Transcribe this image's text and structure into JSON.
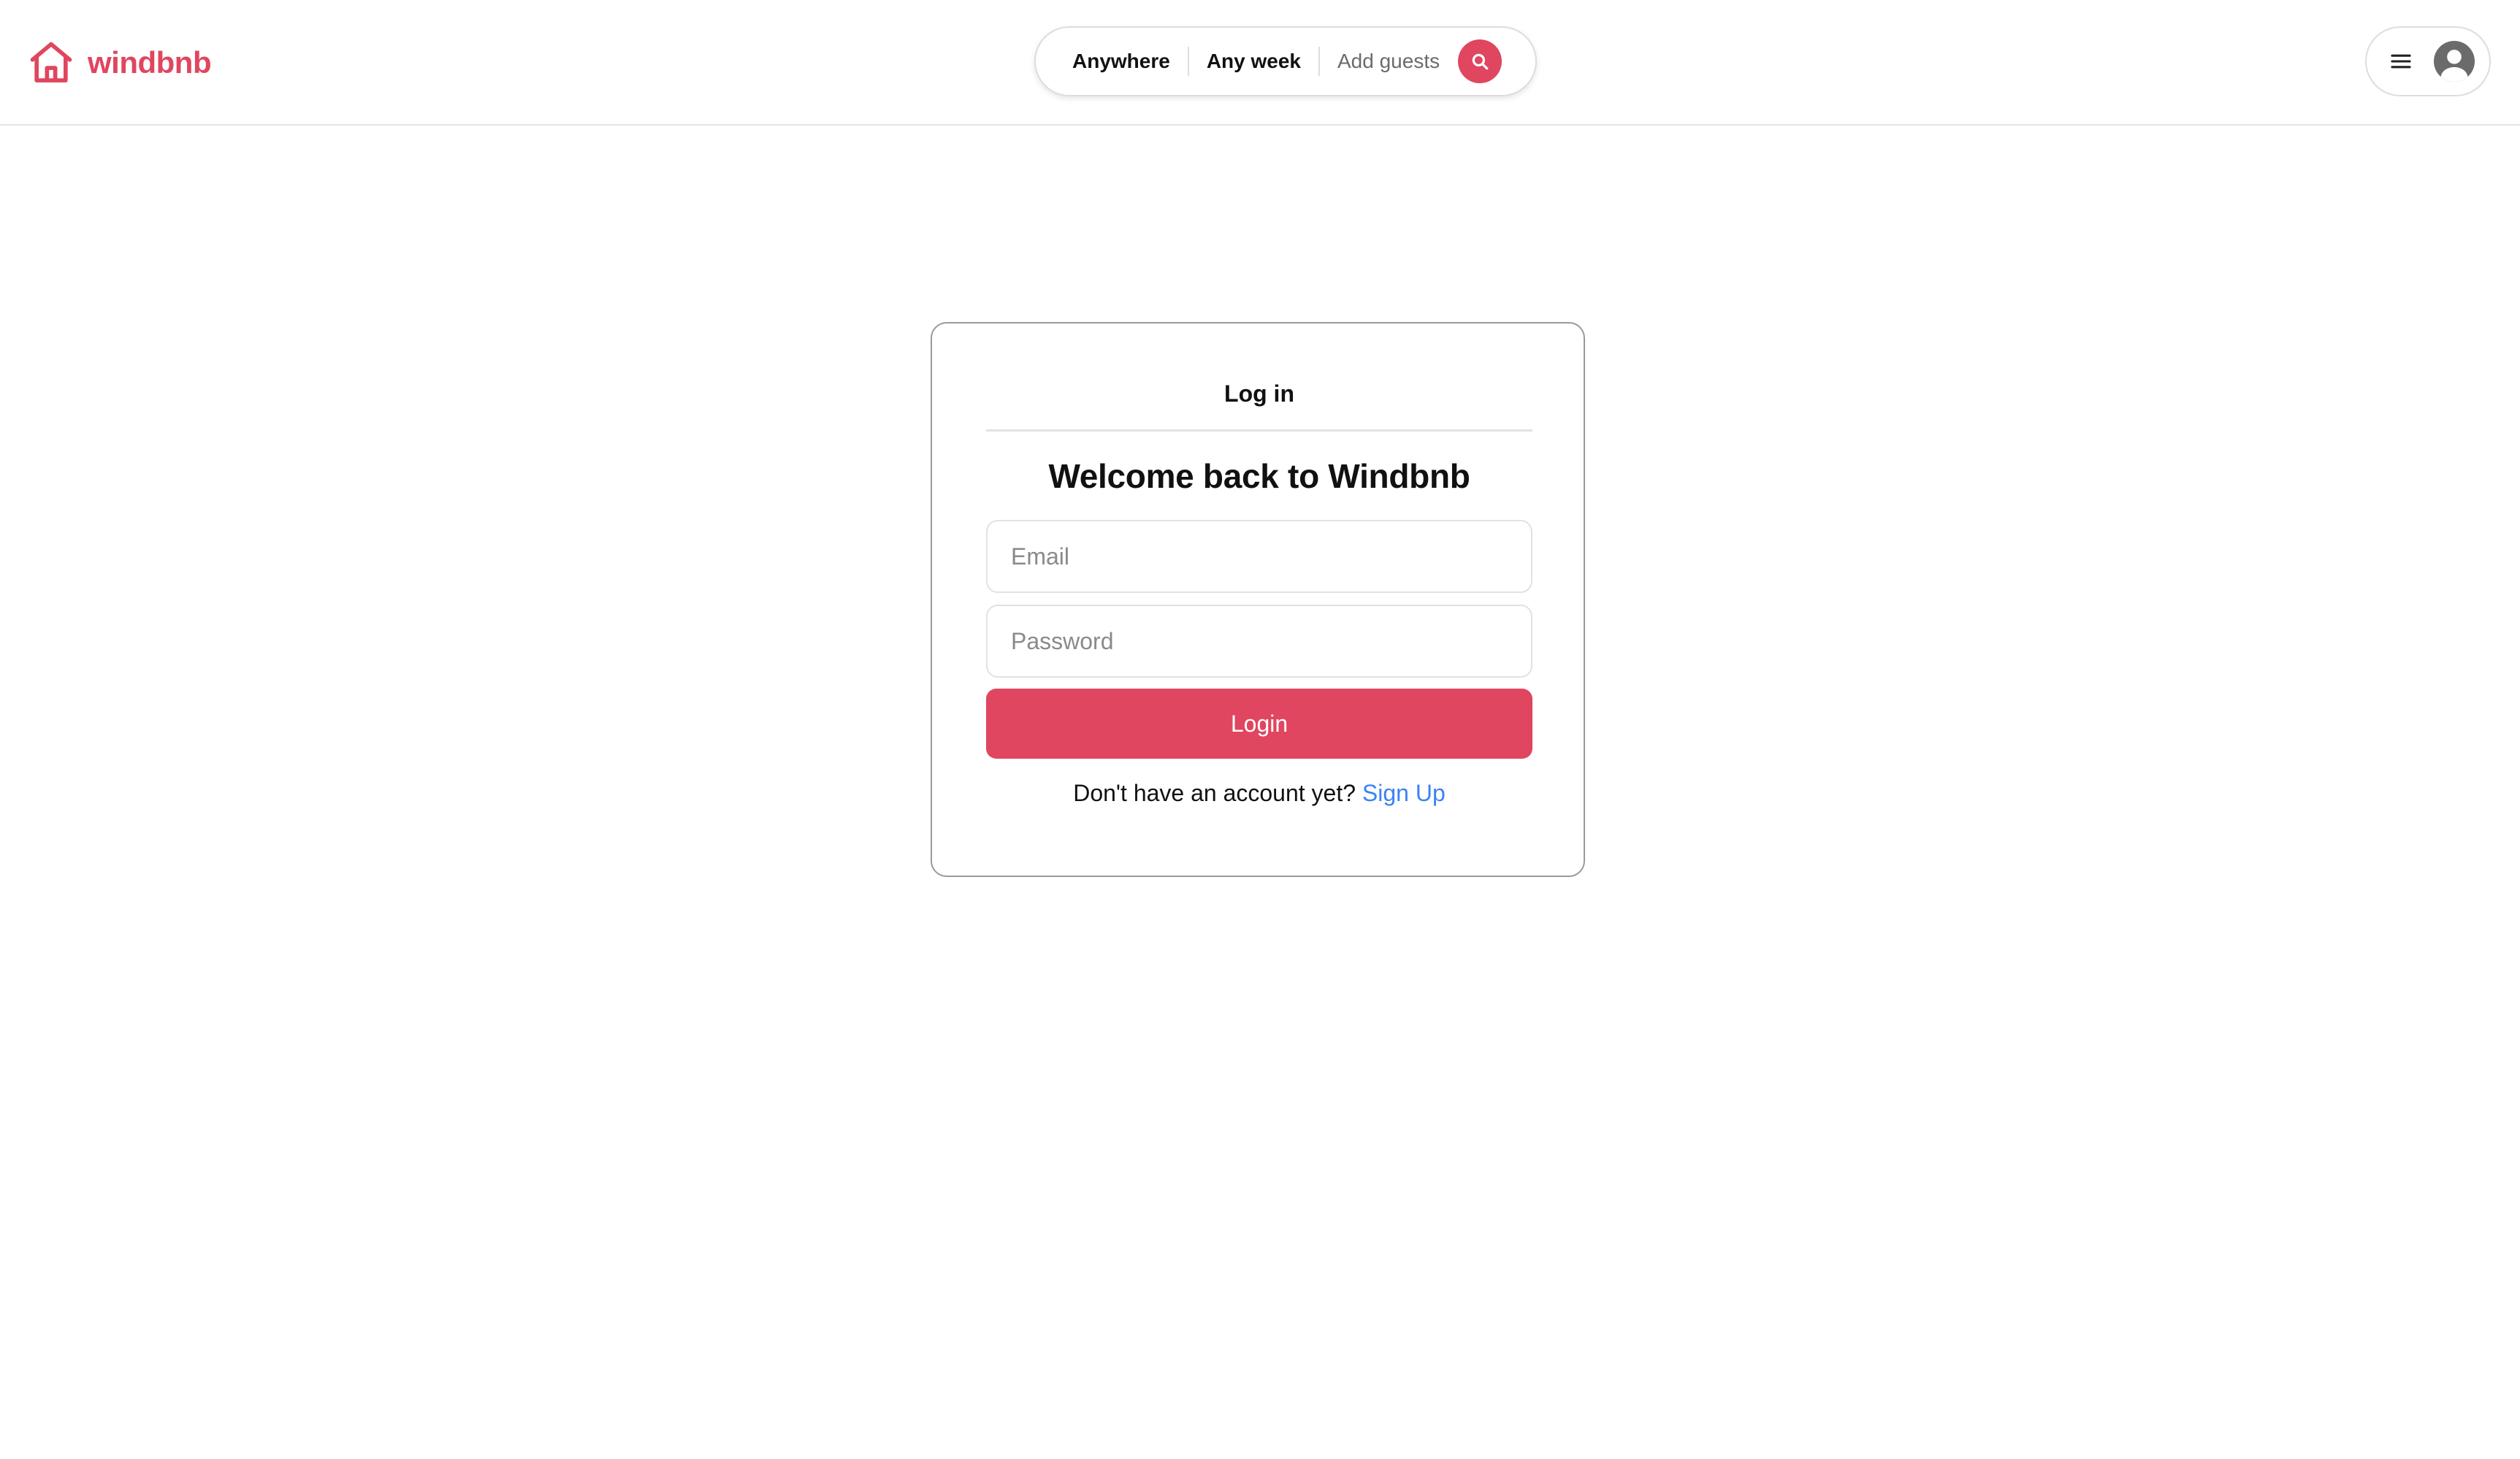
{
  "brand": {
    "name": "windbnb",
    "accent_color": "#e0465f",
    "logo_icon": "house-icon"
  },
  "search": {
    "location_label": "Anywhere",
    "dates_label": "Any week",
    "guests_label": "Add guests",
    "button_icon": "search-icon"
  },
  "user_menu": {
    "menu_icon": "hamburger-menu-icon",
    "avatar_icon": "user-avatar-icon"
  },
  "login": {
    "title": "Log in",
    "heading": "Welcome back to Windbnb",
    "email_placeholder": "Email",
    "password_placeholder": "Password",
    "submit_label": "Login",
    "signup_prompt": "Don't have an account yet?",
    "signup_link_label": "Sign Up",
    "link_color": "#3b82f6"
  }
}
